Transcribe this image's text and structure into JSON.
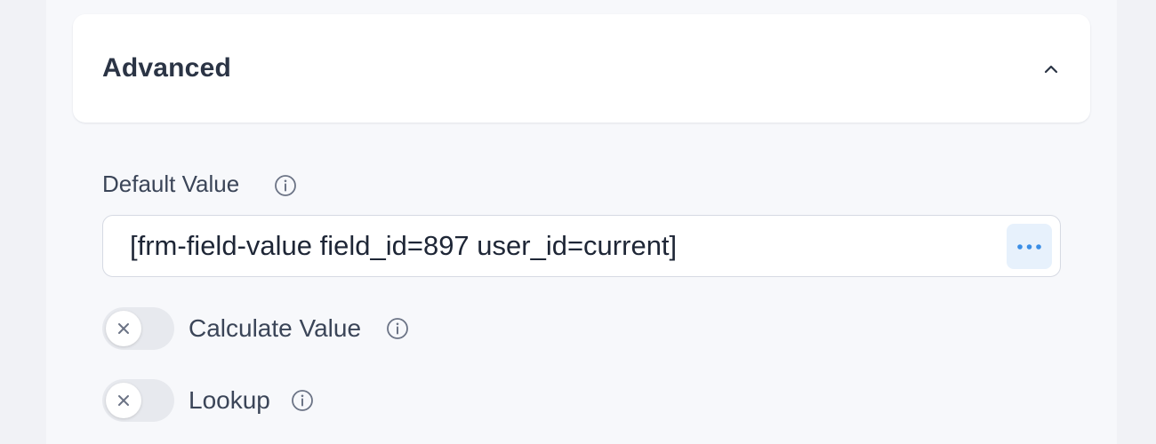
{
  "section": {
    "title": "Advanced",
    "collapse_icon": "chevron-up-icon"
  },
  "default_value": {
    "label": "Default Value",
    "info_icon": "info-icon",
    "value": "[frm-field-value field_id=897 user_id=current]",
    "more_icon": "ellipsis-icon",
    "accent_color": "#3a8ee6"
  },
  "toggles": [
    {
      "label": "Calculate Value",
      "enabled": false,
      "icon": "x-icon"
    },
    {
      "label": "Lookup",
      "enabled": false,
      "icon": "x-icon"
    }
  ]
}
